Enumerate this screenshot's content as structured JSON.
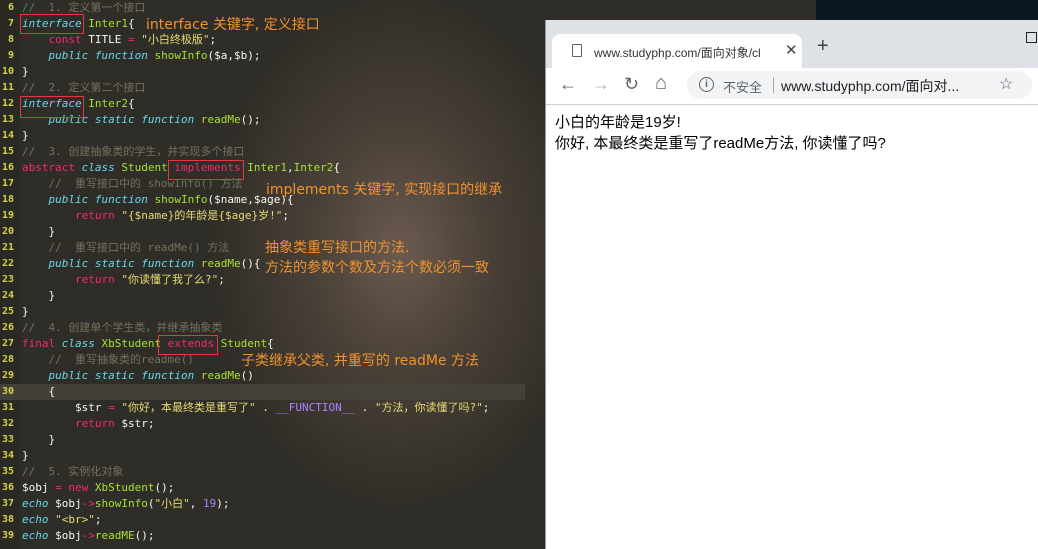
{
  "editor": {
    "lines": [
      {
        "n": "6",
        "segs": [
          [
            "cm",
            "//  1. 定义第一个接口"
          ]
        ]
      },
      {
        "n": "7",
        "segs": [
          [
            "kwi",
            "interface"
          ],
          [
            "pl",
            " "
          ],
          [
            "cls",
            "Inter1"
          ],
          [
            "pl",
            "{"
          ]
        ]
      },
      {
        "n": "8",
        "segs": [
          [
            "pl",
            "    "
          ],
          [
            "kw",
            "const"
          ],
          [
            "pl",
            " TITLE "
          ],
          [
            "kw",
            "="
          ],
          [
            "pl",
            " "
          ],
          [
            "str",
            "\"小白终极版\""
          ],
          [
            "pl",
            ";"
          ]
        ]
      },
      {
        "n": "9",
        "segs": [
          [
            "pl",
            "    "
          ],
          [
            "kwi",
            "public"
          ],
          [
            "pl",
            " "
          ],
          [
            "st",
            "function"
          ],
          [
            "pl",
            " "
          ],
          [
            "fn",
            "showInfo"
          ],
          [
            "pl",
            "($a,$b);"
          ]
        ]
      },
      {
        "n": "10",
        "segs": [
          [
            "pl",
            "}"
          ]
        ]
      },
      {
        "n": "11",
        "segs": [
          [
            "cm",
            "//  2. 定义第二个接口"
          ]
        ]
      },
      {
        "n": "12",
        "segs": [
          [
            "kwi",
            "interface"
          ],
          [
            "pl",
            " "
          ],
          [
            "cls",
            "Inter2"
          ],
          [
            "pl",
            "{"
          ]
        ]
      },
      {
        "n": "13",
        "segs": [
          [
            "pl",
            "    "
          ],
          [
            "kwi",
            "public"
          ],
          [
            "pl",
            " "
          ],
          [
            "kwi",
            "static"
          ],
          [
            "pl",
            " "
          ],
          [
            "st",
            "function"
          ],
          [
            "pl",
            " "
          ],
          [
            "fn",
            "readMe"
          ],
          [
            "pl",
            "();"
          ]
        ]
      },
      {
        "n": "14",
        "segs": [
          [
            "pl",
            "}"
          ]
        ]
      },
      {
        "n": "15",
        "segs": [
          [
            "cm",
            "//  3. 创建抽象类的学生，并实现多个接口"
          ]
        ]
      },
      {
        "n": "16",
        "segs": [
          [
            "kw",
            "abstract"
          ],
          [
            "pl",
            " "
          ],
          [
            "st",
            "class"
          ],
          [
            "pl",
            " "
          ],
          [
            "cls",
            "Student"
          ],
          [
            "pl",
            " "
          ],
          [
            "kw",
            "implements"
          ],
          [
            "pl",
            " "
          ],
          [
            "cls",
            "Inter1"
          ],
          [
            "pl",
            ","
          ],
          [
            "cls",
            "Inter2"
          ],
          [
            "pl",
            "{"
          ]
        ]
      },
      {
        "n": "17",
        "segs": [
          [
            "pl",
            "    "
          ],
          [
            "cm",
            "//  重写接口中的 showInfo() 方法"
          ]
        ]
      },
      {
        "n": "18",
        "segs": [
          [
            "pl",
            "    "
          ],
          [
            "kwi",
            "public"
          ],
          [
            "pl",
            " "
          ],
          [
            "st",
            "function"
          ],
          [
            "pl",
            " "
          ],
          [
            "fn",
            "showInfo"
          ],
          [
            "pl",
            "($name,$age){"
          ]
        ]
      },
      {
        "n": "19",
        "segs": [
          [
            "pl",
            "        "
          ],
          [
            "kw",
            "return"
          ],
          [
            "pl",
            " "
          ],
          [
            "str",
            "\"{$name}的年龄是{$age}岁!\""
          ],
          [
            "pl",
            ";"
          ]
        ]
      },
      {
        "n": "20",
        "segs": [
          [
            "pl",
            "    }"
          ]
        ]
      },
      {
        "n": "21",
        "segs": [
          [
            "pl",
            "    "
          ],
          [
            "cm",
            "//  重写接口中的 readMe() 方法"
          ]
        ]
      },
      {
        "n": "22",
        "segs": [
          [
            "pl",
            "    "
          ],
          [
            "kwi",
            "public"
          ],
          [
            "pl",
            " "
          ],
          [
            "kwi",
            "static"
          ],
          [
            "pl",
            " "
          ],
          [
            "st",
            "function"
          ],
          [
            "pl",
            " "
          ],
          [
            "fn",
            "readMe"
          ],
          [
            "pl",
            "(){"
          ]
        ]
      },
      {
        "n": "23",
        "segs": [
          [
            "pl",
            "        "
          ],
          [
            "kw",
            "return"
          ],
          [
            "pl",
            " "
          ],
          [
            "str",
            "\"你读懂了我了么?\""
          ],
          [
            "pl",
            ";"
          ]
        ]
      },
      {
        "n": "24",
        "segs": [
          [
            "pl",
            "    }"
          ]
        ]
      },
      {
        "n": "25",
        "segs": [
          [
            "pl",
            "}"
          ]
        ]
      },
      {
        "n": "26",
        "segs": [
          [
            "cm",
            "//  4. 创建单个学生类，并继承抽象类"
          ]
        ]
      },
      {
        "n": "27",
        "segs": [
          [
            "kw",
            "final"
          ],
          [
            "pl",
            " "
          ],
          [
            "st",
            "class"
          ],
          [
            "pl",
            " "
          ],
          [
            "cls",
            "XbStudent"
          ],
          [
            "pl",
            " "
          ],
          [
            "kw",
            "extends"
          ],
          [
            "pl",
            " "
          ],
          [
            "cls",
            "Student"
          ],
          [
            "pl",
            "{"
          ]
        ]
      },
      {
        "n": "28",
        "segs": [
          [
            "pl",
            "    "
          ],
          [
            "cm",
            "//  重写抽象类的readme()"
          ]
        ]
      },
      {
        "n": "29",
        "segs": [
          [
            "pl",
            "    "
          ],
          [
            "kwi",
            "public"
          ],
          [
            "pl",
            " "
          ],
          [
            "kwi",
            "static"
          ],
          [
            "pl",
            " "
          ],
          [
            "st",
            "function"
          ],
          [
            "pl",
            " "
          ],
          [
            "fn",
            "readMe"
          ],
          [
            "pl",
            "()"
          ]
        ]
      },
      {
        "n": "30",
        "segs": [
          [
            "pl",
            "    {"
          ]
        ],
        "current": true
      },
      {
        "n": "31",
        "segs": [
          [
            "pl",
            "        $str "
          ],
          [
            "kw",
            "="
          ],
          [
            "pl",
            " "
          ],
          [
            "str",
            "\"你好，本最终类是重写了\""
          ],
          [
            "pl",
            " . "
          ],
          [
            "cst",
            "__FUNCTION__"
          ],
          [
            "pl",
            " . "
          ],
          [
            "str",
            "\"方法，你读懂了吗?\""
          ],
          [
            "pl",
            ";"
          ]
        ]
      },
      {
        "n": "32",
        "segs": [
          [
            "pl",
            "        "
          ],
          [
            "kw",
            "return"
          ],
          [
            "pl",
            " $str;"
          ]
        ]
      },
      {
        "n": "33",
        "segs": [
          [
            "pl",
            "    }"
          ]
        ]
      },
      {
        "n": "34",
        "segs": [
          [
            "pl",
            "}"
          ]
        ]
      },
      {
        "n": "35",
        "segs": [
          [
            "cm",
            "//  5. 实例化对象"
          ]
        ]
      },
      {
        "n": "36",
        "segs": [
          [
            "pl",
            "$obj "
          ],
          [
            "kw",
            "="
          ],
          [
            "pl",
            " "
          ],
          [
            "kw",
            "new"
          ],
          [
            "pl",
            " "
          ],
          [
            "cls",
            "XbStudent"
          ],
          [
            "pl",
            "();"
          ]
        ]
      },
      {
        "n": "37",
        "segs": [
          [
            "kwi",
            "echo"
          ],
          [
            "pl",
            " $obj"
          ],
          [
            "kw",
            "->"
          ],
          [
            "fn",
            "showInfo"
          ],
          [
            "pl",
            "("
          ],
          [
            "str",
            "\"小白\""
          ],
          [
            "pl",
            ", "
          ],
          [
            "num",
            "19"
          ],
          [
            "pl",
            ");"
          ]
        ]
      },
      {
        "n": "38",
        "segs": [
          [
            "kwi",
            "echo"
          ],
          [
            "pl",
            " "
          ],
          [
            "str",
            "\"<br>\""
          ],
          [
            "pl",
            ";"
          ]
        ]
      },
      {
        "n": "39",
        "segs": [
          [
            "kwi",
            "echo"
          ],
          [
            "pl",
            " $obj"
          ],
          [
            "kw",
            "->"
          ],
          [
            "fn",
            "readME"
          ],
          [
            "pl",
            "();"
          ]
        ]
      }
    ]
  },
  "annotations": {
    "interface": "interface 关键字, 定义接口",
    "implements": "implements 关键字, 实现接口的继承",
    "abstract_1": "抽象类重写接口的方法.",
    "abstract_2": "方法的参数个数及方法个数必须一致",
    "extends": "子类继承父类, 并重写的 readMe 方法"
  },
  "browser": {
    "tab_title": "www.studyphp.com/面向对象/cl",
    "tab_close": "✕",
    "new_tab": "+",
    "back": "←",
    "forward": "→",
    "reload": "↻",
    "home": "⌂",
    "info_glyph": "i",
    "insecure_label": "不安全",
    "url": "www.studyphp.com/面向对...",
    "star": "☆",
    "output": [
      "小白的年龄是19岁!",
      "你好, 本最终类是重写了readMe方法, 你读懂了吗?"
    ]
  },
  "colors": {
    "annotation": "#f0922d",
    "highlight_box": "#e03b3b",
    "line_number": "#d6d04a"
  }
}
